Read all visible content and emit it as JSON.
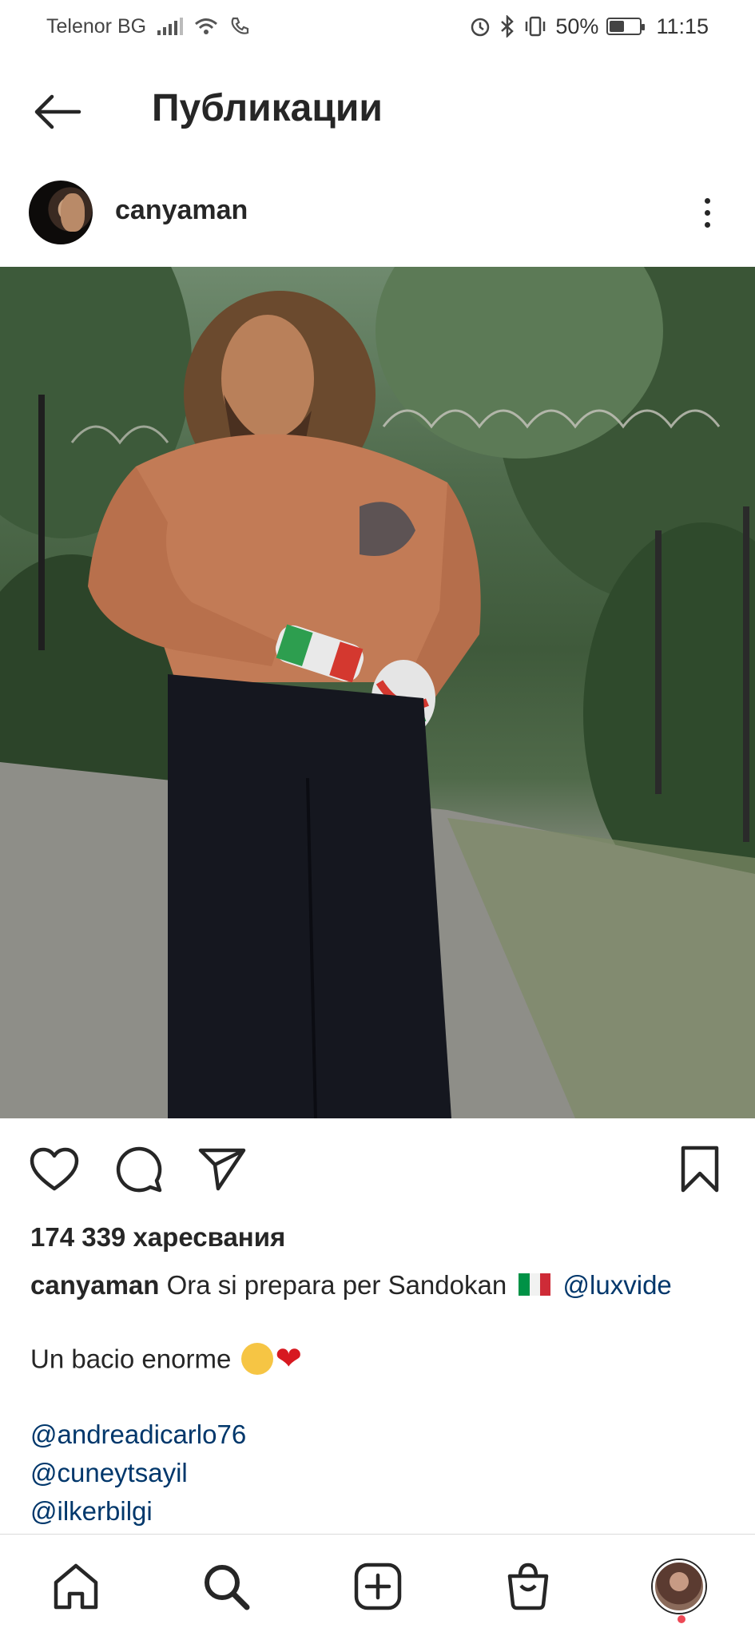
{
  "status_bar": {
    "carrier": "Telenor BG",
    "battery": "50%",
    "battery_level": 0.5,
    "time": "11:15",
    "icons": [
      "signal-icon",
      "wifi-icon",
      "wifi-calling-icon",
      "alarm-icon",
      "bluetooth-icon",
      "vibrate-icon",
      "battery-icon"
    ]
  },
  "header": {
    "title": "Публикации",
    "back_icon": "arrow-left-icon"
  },
  "post": {
    "username": "canyaman",
    "more_icon": "more-vertical-icon",
    "image_alt": "Shirtless man with long hair and beard wearing dark shorts and hand wraps in Italian flag colors, standing on a road by a fence and trees"
  },
  "actions": {
    "like_icon": "heart-icon",
    "comment_icon": "comment-icon",
    "share_icon": "send-icon",
    "save_icon": "bookmark-icon"
  },
  "likes": "174 339 харесвания",
  "caption": {
    "username": "canyaman",
    "text": "Ora si prepara per Sandokan",
    "mention": "@luxvide",
    "line2": "Un bacio enorme",
    "mentions": [
      "@andreadicarlo76",
      "@cuneytsayil",
      "@ilkerbilgi"
    ]
  },
  "bottom_nav": {
    "items": [
      {
        "name": "home",
        "icon": "home-icon"
      },
      {
        "name": "search",
        "icon": "search-icon"
      },
      {
        "name": "create",
        "icon": "add-square-icon"
      },
      {
        "name": "shop",
        "icon": "shopping-bag-icon"
      },
      {
        "name": "profile",
        "icon": "profile-avatar"
      }
    ]
  },
  "colors": {
    "text": "#262626",
    "mention": "#00376b",
    "notification": "#ed4956"
  }
}
